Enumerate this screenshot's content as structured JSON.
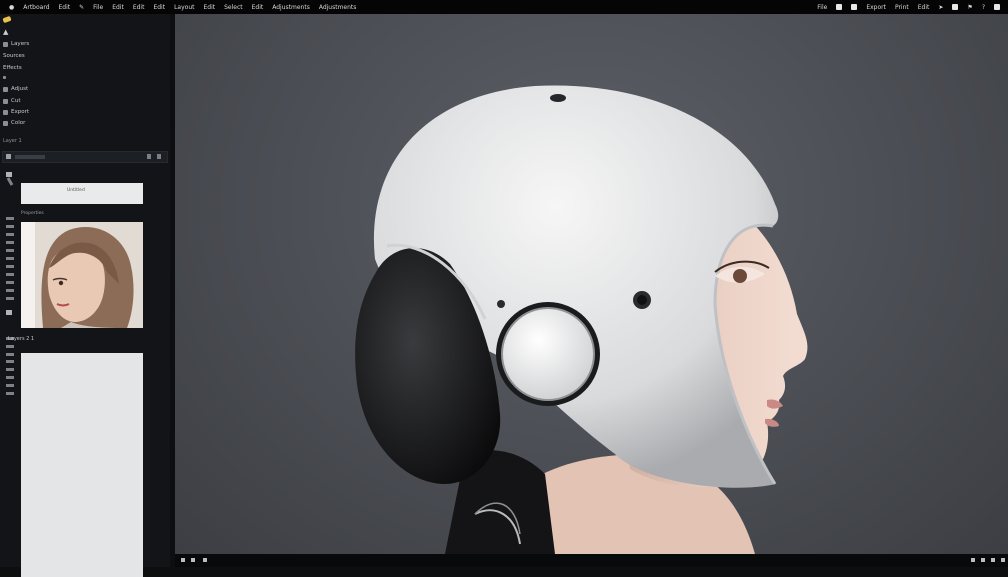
{
  "menubar": {
    "items": [
      "Artboard",
      "Edit",
      "File",
      "Edit",
      "Edit",
      "Edit",
      "Layout",
      "Edit",
      "Select",
      "Edit",
      "Adjustments",
      "Adjustments"
    ],
    "right_items": [
      "File",
      "Export",
      "Print",
      "Edit"
    ]
  },
  "sidebar": {
    "items": [
      "Layers",
      "Sources",
      "Effects",
      "Adjust",
      "Cut",
      "Export",
      "Color"
    ],
    "path": "Layer 1",
    "panel_title": "Untitled",
    "section_label": "Properties",
    "layers_label": "Layers 2 1"
  },
  "canvas": {
    "subject": "portrait-helmet"
  }
}
